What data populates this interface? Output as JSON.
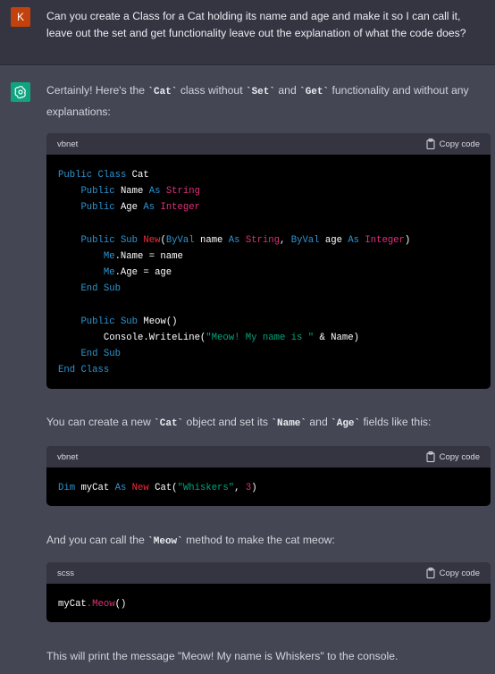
{
  "user": {
    "avatar_letter": "K",
    "message": "Can you create a Class for a Cat holding its name and age and make it so I can call it, leave out the set and get functionality leave out the explanation of what the code does?"
  },
  "assistant": {
    "intro": {
      "t1": "Certainly! Here's the ",
      "c1": "`Cat`",
      "t2": " class without ",
      "c2": "`Set`",
      "t3": " and ",
      "c3": "`Get`",
      "t4": " functionality and without any explanations:"
    },
    "block1": {
      "lang": "vbnet",
      "copy_label": "Copy code",
      "code": {
        "l1_public": "Public",
        "l1_class": "Class",
        "l1_cat": "Cat",
        "l2_public": "Public",
        "l2_name": "Name",
        "l2_as": "As",
        "l2_type": "String",
        "l3_public": "Public",
        "l3_age": "Age",
        "l3_as": "As",
        "l3_type": "Integer",
        "l5_public": "Public",
        "l5_sub": "Sub",
        "l5_new": "New",
        "l5_p1": "(",
        "l5_byval1": "ByVal",
        "l5_name": "name",
        "l5_as1": "As",
        "l5_string": "String",
        "l5_comma": ",",
        "l5_byval2": "ByVal",
        "l5_age": "age",
        "l5_as2": "As",
        "l5_integer": "Integer",
        "l5_p2": ")",
        "l6_me": "Me",
        "l6_rest": ".Name = name",
        "l7_me": "Me",
        "l7_rest": ".Age = age",
        "l8_end": "End",
        "l8_sub": "Sub",
        "l10_public": "Public",
        "l10_sub": "Sub",
        "l10_meow": "Meow()",
        "l11_console": "Console.WriteLine(",
        "l11_str": "\"Meow! My name is \"",
        "l11_rest": " & Name)",
        "l12_end": "End",
        "l12_sub": "Sub",
        "l13_end": "End",
        "l13_class": "Class"
      }
    },
    "mid": {
      "t1": "You can create a new ",
      "c1": "`Cat`",
      "t2": " object and set its ",
      "c2": "`Name`",
      "t3": " and ",
      "c3": "`Age`",
      "t4": " fields like this:"
    },
    "block2": {
      "lang": "vbnet",
      "copy_label": "Copy code",
      "code": {
        "dim": "Dim",
        "var": "myCat",
        "as": "As",
        "new": "New",
        "cat": "Cat(",
        "str": "\"Whiskers\"",
        "comma": ", ",
        "num": "3",
        "close": ")"
      }
    },
    "call": {
      "t1": "And you can call the ",
      "c1": "`Meow`",
      "t2": " method to make the cat meow:"
    },
    "block3": {
      "lang": "scss",
      "copy_label": "Copy code",
      "code": {
        "obj": "myCat",
        "method": ".Meow",
        "parens": "()"
      }
    },
    "outro": "This will print the message \"Meow! My name is Whiskers\" to the console."
  },
  "colors": {
    "user_bg": "#343541",
    "assistant_bg": "#444654",
    "code_bg": "#000000",
    "code_header_bg": "#343541",
    "gpt_green": "#10a37f",
    "user_avatar": "#c2410c",
    "keyword": "#2e95d3",
    "string": "#00a67d",
    "type": "#df3079"
  }
}
